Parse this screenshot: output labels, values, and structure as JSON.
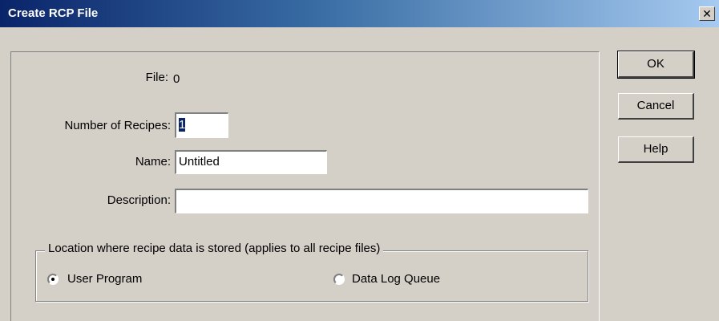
{
  "window": {
    "title": "Create RCP File",
    "close_glyph": "✕"
  },
  "form": {
    "file_label": "File:",
    "file_value": "0",
    "num_recipes_label": "Number of Recipes:",
    "num_recipes_value": "1",
    "name_label": "Name:",
    "name_value": "Untitled",
    "description_label": "Description:",
    "description_value": ""
  },
  "location": {
    "legend": "Location where recipe data is stored  (applies to all recipe files)",
    "options": [
      {
        "label": "User Program",
        "selected": true
      },
      {
        "label": "Data Log Queue",
        "selected": false
      }
    ]
  },
  "buttons": {
    "ok": "OK",
    "cancel": "Cancel",
    "help": "Help"
  }
}
